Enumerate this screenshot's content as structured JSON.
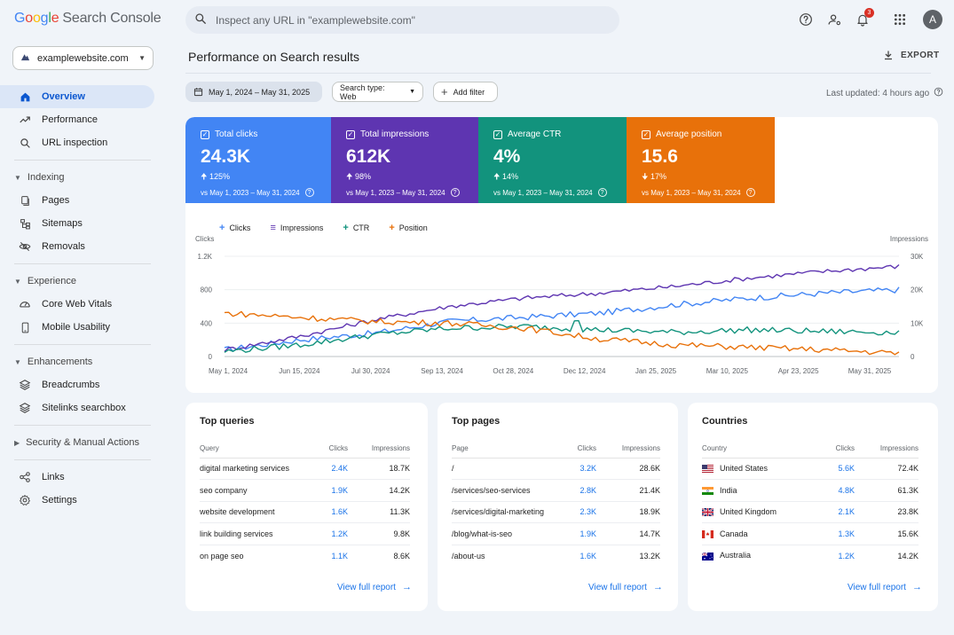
{
  "app": {
    "logo_google": "Google",
    "logo_product": "Search Console"
  },
  "search": {
    "placeholder": "Inspect any URL in \"examplewebsite.com\""
  },
  "topbar": {
    "notification_count": "3",
    "avatar_letter": "A"
  },
  "property": {
    "label": "examplewebsite.com"
  },
  "sidebar": {
    "overview": "Overview",
    "performance": "Performance",
    "url_inspection": "URL inspection",
    "indexing": "Indexing",
    "pages": "Pages",
    "sitemaps": "Sitemaps",
    "removals": "Removals",
    "experience": "Experience",
    "core_web_vitals": "Core Web Vitals",
    "mobile_usability": "Mobile Usability",
    "enhancements": "Enhancements",
    "breadcrumbs": "Breadcrumbs",
    "sitelinks": "Sitelinks searchbox",
    "security": "Security & Manual Actions",
    "links": "Links",
    "settings": "Settings"
  },
  "header": {
    "title": "Performance on Search results",
    "export_label": "EXPORT"
  },
  "filters": {
    "date_range": "May 1, 2024 – May 31, 2025",
    "search_type": "Search type: Web",
    "add_filter": "Add filter",
    "last_updated": "Last updated: 4 hours ago"
  },
  "metrics": [
    {
      "label": "Total clicks",
      "value": "24.3K",
      "change": "125%",
      "direction": "up",
      "vs": "vs May 1, 2023 – May 31, 2024",
      "color": "#4285f4"
    },
    {
      "label": "Total impressions",
      "value": "612K",
      "change": "98%",
      "direction": "up",
      "vs": "vs May 1, 2023 – May 31, 2024",
      "color": "#5e35b1"
    },
    {
      "label": "Average CTR",
      "value": "4%",
      "change": "14%",
      "direction": "up",
      "vs": "vs May 1, 2023 – May 31, 2024",
      "color": "#12937d"
    },
    {
      "label": "Average position",
      "value": "15.6",
      "change": "17%",
      "direction": "down",
      "vs": "vs May 1, 2023 – May 31, 2024",
      "color": "#e8710a"
    }
  ],
  "chart_data": {
    "type": "line",
    "legend": [
      "Clicks",
      "Impressions",
      "CTR",
      "Position"
    ],
    "ylabel_left": "Clicks",
    "ylabel_right": "Impressions",
    "left_ticks": [
      "1.2K",
      "800",
      "400",
      "0"
    ],
    "right_ticks": [
      "30K",
      "20K",
      "10K",
      "0"
    ],
    "ylim_left": [
      0,
      1200
    ],
    "ylim_right": [
      0,
      30000
    ],
    "x_labels": [
      "May 1, 2024",
      "Jun 15, 2024",
      "Jul 30, 2024",
      "Sep 13, 2024",
      "Oct 28, 2024",
      "Dec 12, 2024",
      "Jan 25, 2025",
      "Mar 10, 2025",
      "Apr 23, 2025",
      "May 31, 2025"
    ],
    "x_points": [
      "May 1, 2024",
      "Jun 15, 2024",
      "Jul 30, 2024",
      "Sep 13, 2024",
      "Oct 28, 2024",
      "Dec 12, 2024",
      "Jan 25, 2025",
      "Mar 10, 2025",
      "Apr 23, 2025",
      "May 31, 2025"
    ],
    "series": [
      {
        "name": "Clicks",
        "axis": "left",
        "color": "#4285f4",
        "values": [
          80,
          200,
          280,
          420,
          470,
          520,
          620,
          700,
          760,
          800
        ]
      },
      {
        "name": "Impressions",
        "axis": "right",
        "color": "#5e35b1",
        "values": [
          2000,
          6000,
          11000,
          15000,
          17500,
          19000,
          21000,
          23500,
          25500,
          27000
        ]
      },
      {
        "name": "CTR",
        "axis": "left",
        "color": "#12937d",
        "values": [
          60,
          140,
          260,
          340,
          360,
          320,
          290,
          320,
          300,
          290
        ]
      },
      {
        "name": "Position",
        "axis": "left",
        "color": "#e8710a",
        "values": [
          520,
          470,
          420,
          400,
          340,
          210,
          140,
          110,
          80,
          40
        ]
      }
    ]
  },
  "tables": {
    "queries": {
      "title": "Top queries",
      "col1": "Query",
      "col2": "Clicks",
      "col3": "Impressions",
      "rows": [
        [
          "digital marketing services",
          "2.4K",
          "18.7K"
        ],
        [
          "seo company",
          "1.9K",
          "14.2K"
        ],
        [
          "website development",
          "1.6K",
          "11.3K"
        ],
        [
          "link building services",
          "1.2K",
          "9.8K"
        ],
        [
          "on page seo",
          "1.1K",
          "8.6K"
        ]
      ],
      "link": "View full report"
    },
    "pages": {
      "title": "Top pages",
      "col1": "Page",
      "col2": "Clicks",
      "col3": "Impressions",
      "rows": [
        [
          "/",
          "3.2K",
          "28.6K"
        ],
        [
          "/services/seo-services",
          "2.8K",
          "21.4K"
        ],
        [
          "/services/digital-marketing",
          "2.3K",
          "18.9K"
        ],
        [
          "/blog/what-is-seo",
          "1.9K",
          "14.7K"
        ],
        [
          "/about-us",
          "1.6K",
          "13.2K"
        ]
      ],
      "link": "View full report"
    },
    "countries": {
      "title": "Countries",
      "col1": "Country",
      "col2": "Clicks",
      "col3": "Impressions",
      "rows": [
        [
          "United States",
          "5.6K",
          "72.4K"
        ],
        [
          "India",
          "4.8K",
          "61.3K"
        ],
        [
          "United Kingdom",
          "2.1K",
          "23.8K"
        ],
        [
          "Canada",
          "1.3K",
          "15.6K"
        ],
        [
          "Australia",
          "1.2K",
          "14.2K"
        ]
      ],
      "flags": [
        "us-flag",
        "in-flag",
        "gb-flag",
        "ca-flag",
        "au-flag"
      ],
      "link": "View full report"
    }
  }
}
